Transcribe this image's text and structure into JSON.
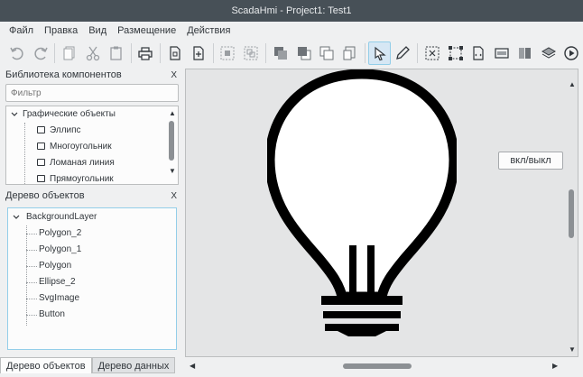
{
  "window": {
    "title": "ScadaHmi - Project1: Test1"
  },
  "menu": {
    "items": [
      "Файл",
      "Правка",
      "Вид",
      "Размещение",
      "Действия"
    ]
  },
  "toolbar": {
    "icons": [
      "undo-icon",
      "redo-icon",
      "copy-icon",
      "cut-icon",
      "paste-icon",
      "print-icon",
      "page-settings-icon",
      "page-export-icon",
      "group-icon",
      "ungroup-icon",
      "bring-front-icon",
      "bring-forward-icon",
      "send-backward-icon",
      "send-back-icon",
      "select-icon",
      "pencil-icon",
      "align-icon",
      "resize-icon",
      "code-icon",
      "field-icon",
      "book-icon",
      "layers-icon",
      "run-icon"
    ]
  },
  "library_panel": {
    "title": "Библиотека компонентов",
    "close": "X",
    "filter_placeholder": "Фильтр",
    "category": "Графические объекты",
    "items": [
      "Эллипс",
      "Многоугольник",
      "Ломаная линия",
      "Прямоугольник"
    ]
  },
  "object_tree_panel": {
    "title": "Дерево объектов",
    "close": "X",
    "root": "BackgroundLayer",
    "children": [
      "Polygon_2",
      "Polygon_1",
      "Polygon",
      "Ellipse_2",
      "SvgImage",
      "Button"
    ]
  },
  "bottom_tabs": {
    "objects": "Дерево объектов",
    "data": "Дерево данных"
  },
  "canvas": {
    "button_label": "вкл/выкл"
  },
  "colors": {
    "titlebar": "#475057",
    "background": "#eff0f1",
    "selection": "#93cee9",
    "canvas": "#e4e5e6"
  }
}
